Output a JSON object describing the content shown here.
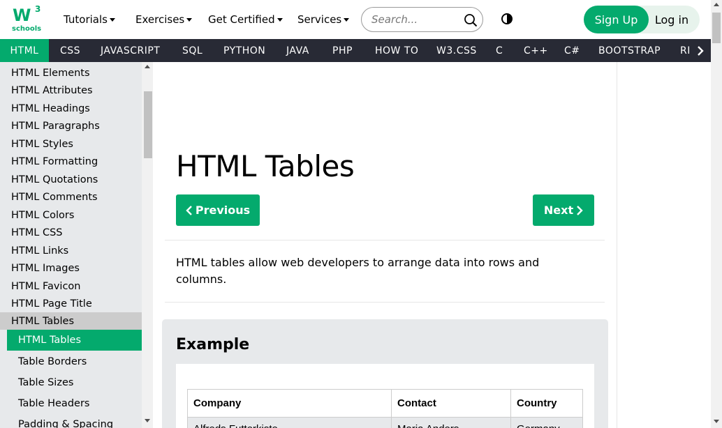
{
  "logo": {
    "mark": "W",
    "superscript": "3",
    "text": "schools"
  },
  "topnav": [
    {
      "label": "Tutorials"
    },
    {
      "label": "Exercises"
    },
    {
      "label": "Get Certified"
    },
    {
      "label": "Services"
    }
  ],
  "search": {
    "placeholder": "Search..."
  },
  "auth": {
    "signup": "Sign Up",
    "login": "Log in"
  },
  "subjects": [
    "HTML",
    "CSS",
    "JAVASCRIPT",
    "SQL",
    "PYTHON",
    "JAVA",
    "PHP",
    "HOW TO",
    "W3.CSS",
    "C",
    "C++",
    "C#",
    "BOOTSTRAP",
    "RE"
  ],
  "sidebar": {
    "items": [
      "HTML Elements",
      "HTML Attributes",
      "HTML Headings",
      "HTML Paragraphs",
      "HTML Styles",
      "HTML Formatting",
      "HTML Quotations",
      "HTML Comments",
      "HTML Colors",
      "HTML CSS",
      "HTML Links",
      "HTML Images",
      "HTML Favicon",
      "HTML Page Title",
      "HTML Tables"
    ],
    "current": "HTML Tables",
    "subitems": [
      "Table Borders",
      "Table Sizes",
      "Table Headers",
      "Padding & Spacing"
    ]
  },
  "main": {
    "title": "HTML Tables",
    "prev_label": "Previous",
    "next_label": "Next",
    "intro": "HTML tables allow web developers to arrange data into rows and columns.",
    "example_title": "Example",
    "table_headers": [
      "Company",
      "Contact",
      "Country"
    ],
    "table_first_row": [
      "Alfreds Futterkiste",
      "Maria Anders",
      "Germany"
    ]
  },
  "colors": {
    "accent": "#04AA6D",
    "subject_bar": "#282A35",
    "sidebar_bg": "#E7E9EB"
  }
}
